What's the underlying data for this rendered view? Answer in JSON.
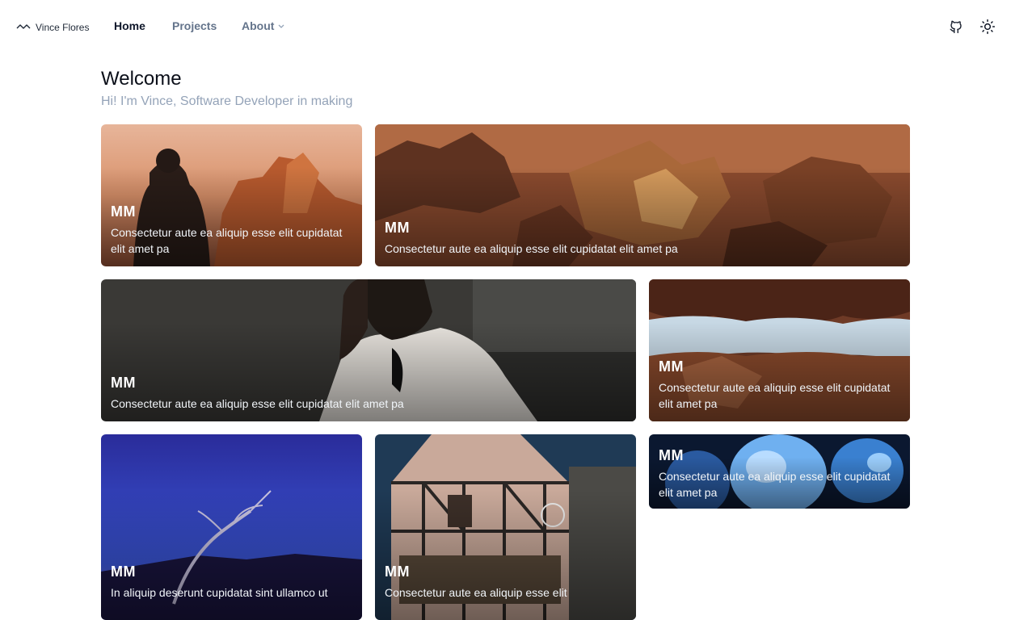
{
  "nav": {
    "brand": "Vince Flores",
    "links": {
      "home": "Home",
      "projects": "Projects",
      "about": "About"
    }
  },
  "hero": {
    "title": "Welcome",
    "subtitle": "Hi! I'm Vince, Software Developer in making"
  },
  "cards": [
    {
      "heading": "MM",
      "text": "Consectetur aute ea aliquip esse elit cupidatat elit amet pa",
      "image": "man-desert-sunset"
    },
    {
      "heading": "MM",
      "text": "Consectetur aute ea aliquip esse elit cupidatat elit amet pa",
      "image": "desert-rock-formations"
    },
    {
      "heading": "MM",
      "text": "Consectetur aute ea aliquip esse elit cupidatat elit amet pa",
      "image": "woman-white-blouse"
    },
    {
      "heading": "MM",
      "text": "Consectetur aute ea aliquip esse elit cupidatat elit amet pa",
      "image": "canyon-sky-view"
    },
    {
      "heading": "MM",
      "text": "Consectetur aute ea aliquip esse elit cupidatat elit amet pa",
      "image": "blue-robot-faces"
    },
    {
      "heading": "MM",
      "text": "In aliquip deserunt cupidatat sint ullamco ut",
      "image": "star-trails-tree"
    },
    {
      "heading": "MM",
      "text": "Consectetur aute ea aliquip esse elit",
      "image": "half-timbered-house-night"
    }
  ],
  "icons": {
    "logo": "wave-icon",
    "github": "github-icon",
    "theme": "sun-icon",
    "dropdown": "chevron-down-icon"
  },
  "colors": {
    "text": "#0b0f19",
    "muted": "#94a3b8",
    "nav_muted": "#64748b"
  }
}
